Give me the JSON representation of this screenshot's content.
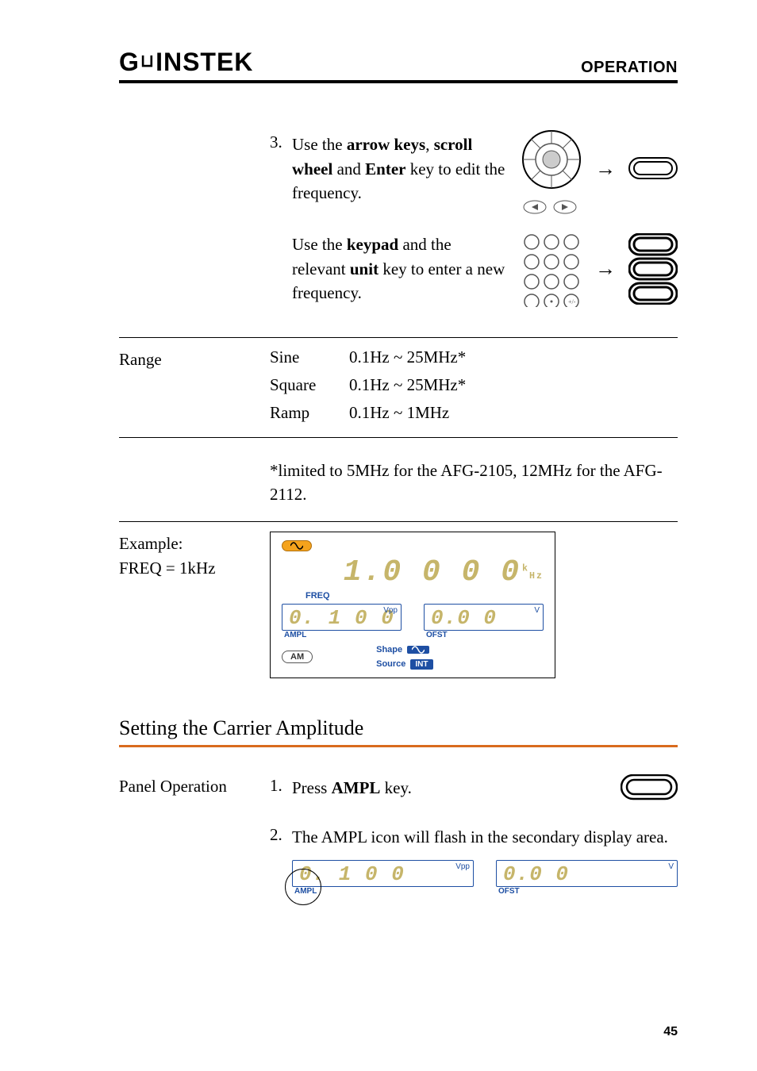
{
  "header": {
    "logo_text": "GWINSTEK",
    "section": "OPERATION"
  },
  "step3": {
    "number": "3.",
    "text_parts": [
      "Use the ",
      "arrow keys",
      ", ",
      "scroll wheel",
      " and ",
      "Enter",
      " key to edit the frequency."
    ]
  },
  "step_keypad": {
    "text_parts": [
      "Use the ",
      "keypad",
      " and the relevant ",
      "unit",
      " key to enter a new frequency."
    ]
  },
  "range": {
    "label": "Range",
    "rows": [
      {
        "wave": "Sine",
        "range": "0.1Hz ~ 25MHz*"
      },
      {
        "wave": "Square",
        "range": "0.1Hz ~ 25MHz*"
      },
      {
        "wave": "Ramp",
        "range": "0.1Hz ~ 1MHz"
      }
    ],
    "footnote": "*limited to 5MHz for the AFG-2105, 12MHz for the AFG-2112."
  },
  "example": {
    "label_line1": "Example:",
    "label_line2": "FREQ = 1kHz",
    "freq_display": "1.0 0 0 0",
    "freq_unit_sup": "k",
    "freq_unit_sub": "Hz",
    "freq_lbl": "FREQ",
    "ampl_val": "0. 1 0 0",
    "ampl_sup": "Vpp",
    "ampl_lbl": "AMPL",
    "ofst_val": "0.0 0",
    "ofst_sup": "V",
    "ofst_lbl": "OFST",
    "am_pill": "AM",
    "shape_lbl": "Shape",
    "source_lbl": "Source",
    "source_badge": "INT"
  },
  "carrier_amp": {
    "heading": "Setting the Carrier Amplitude",
    "panel_op_label": "Panel Operation",
    "step1_num": "1.",
    "step1_text_parts": [
      "Press ",
      "AMPL",
      " key."
    ],
    "step2_num": "2.",
    "step2_text": "The AMPL icon will flash in the secondary display area.",
    "flash_ampl_val": "0. 1 0 0",
    "flash_ampl_sup": "Vpp",
    "flash_ampl_lbl": "AMPL",
    "flash_ofst_val": "0.0 0",
    "flash_ofst_sup": "V",
    "flash_ofst_lbl": "OFST"
  },
  "icons": {
    "sine_pill": "sine-icon"
  },
  "page_number": "45"
}
